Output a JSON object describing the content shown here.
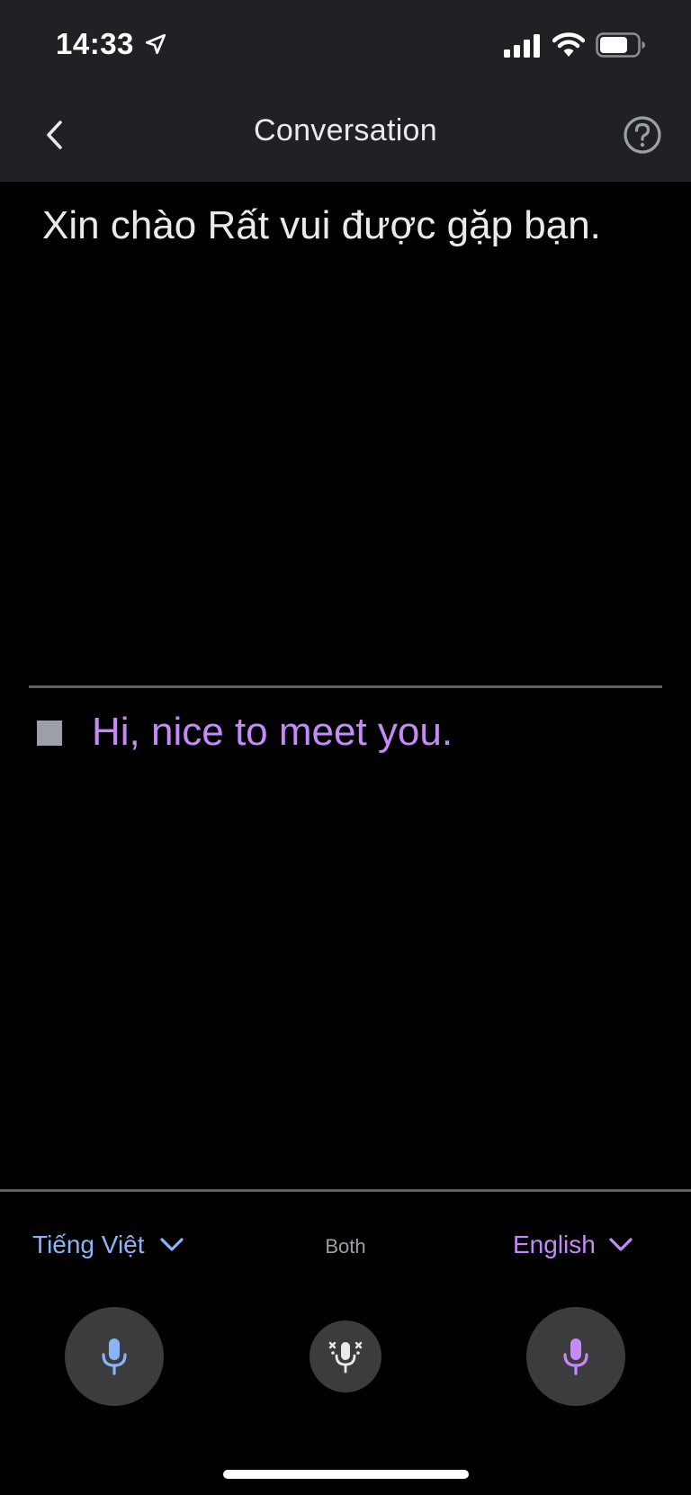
{
  "status_bar": {
    "time": "14:33",
    "icons": [
      "location-arrow-icon",
      "cellular-signal-icon",
      "wifi-icon",
      "battery-icon"
    ]
  },
  "header": {
    "title": "Conversation",
    "back_icon": "chevron-left-icon",
    "help_icon": "help-circle-icon"
  },
  "conversation": {
    "source_text": "Xin chào Rất vui được gặp bạn.",
    "translation_text": "Hi, nice to meet you.",
    "stop_icon": "stop-square-icon"
  },
  "languages": {
    "left": {
      "label": "Tiếng Việt",
      "icon": "chevron-down-icon"
    },
    "center": {
      "label": "Both"
    },
    "right": {
      "label": "English",
      "icon": "chevron-down-icon"
    }
  },
  "mics": {
    "left_icon": "microphone-icon",
    "center_icon": "auto-microphone-icon",
    "right_icon": "microphone-icon"
  },
  "colors": {
    "header_bg": "#202124",
    "background": "#000000",
    "source_text": "#e8eaed",
    "translation_text": "#c58af9",
    "left_lang_accent": "#8ab4f8",
    "right_lang_accent": "#c58af9",
    "mic_button_bg": "#3c3c3e",
    "divider": "#5f6368"
  }
}
